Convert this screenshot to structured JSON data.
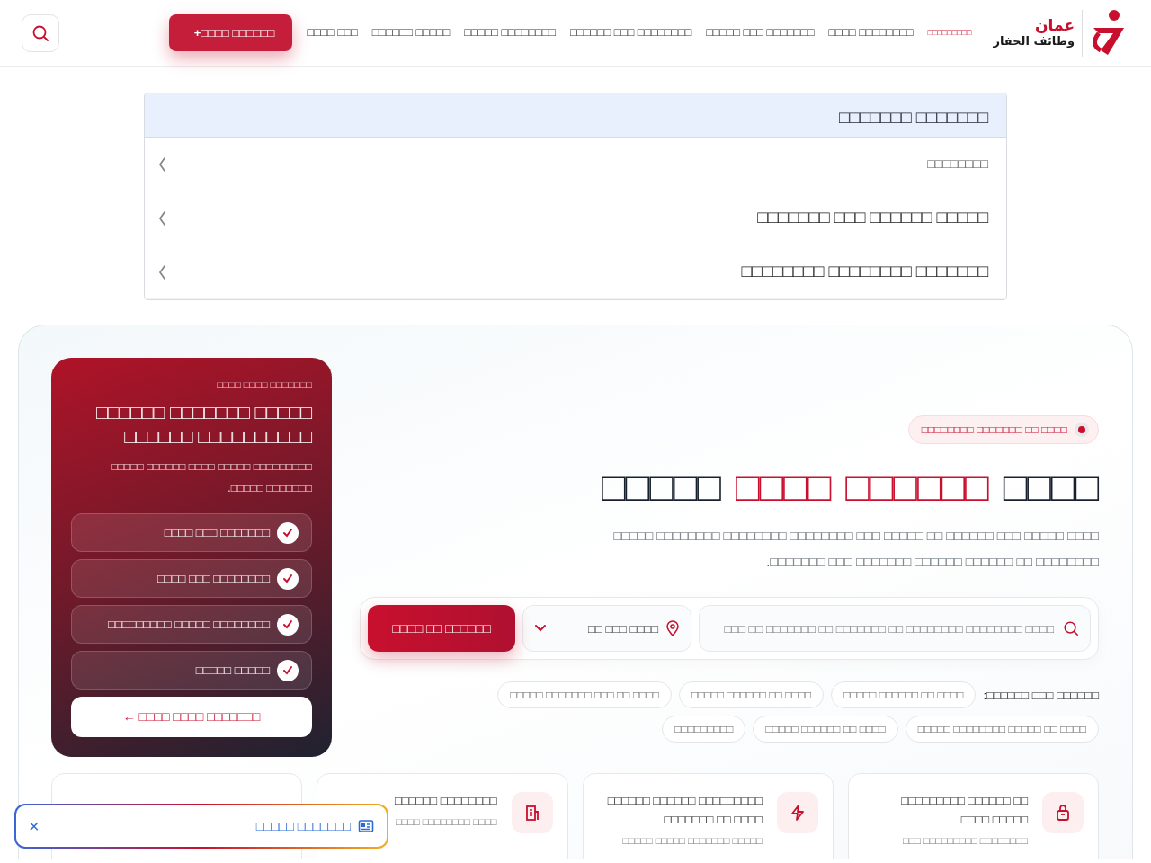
{
  "header": {
    "logo": {
      "line_1": "عمان",
      "line_2": "وظائف الحفار"
    },
    "nav": [
      {
        "label": "□□□ □□□□",
        "selected": false
      },
      {
        "label": "□□□□□ □□□□□□",
        "selected": false
      },
      {
        "label": "□□□□□□□□ □□□□□",
        "selected": false
      },
      {
        "label": "□□□□□□□□ □□□ □□□□□□",
        "selected": false
      },
      {
        "label": "□□□□□□□ □□□ □□□□□",
        "selected": false
      },
      {
        "label": "□□□□□□□□ □□□□",
        "selected": false
      },
      {
        "label": "□□□□□□□□□",
        "selected": true
      }
    ],
    "post_button": {
      "icon": "+",
      "label": "□□□□□□ □□□□"
    }
  },
  "menu": {
    "title": "□□□□□□□ □□□□□□□",
    "items": [
      {
        "label": "□□□□□□□□",
        "kind": "muted"
      },
      {
        "label": "□□□□□ □□□□□□ □□□ □□□□□□□",
        "kind": "normal"
      },
      {
        "label": "□□□□□□□ □□□□□□□□ □□□□□□□□",
        "kind": "normal"
      }
    ]
  },
  "hero": {
    "badge": "□□□□ □□ □□□□□□□ □□□□□□□□",
    "title": [
      {
        "text": "□□□□□",
        "highlight": false
      },
      {
        "text": "□□□□",
        "highlight": true
      },
      {
        "text": "□□□□□□",
        "highlight": true
      },
      {
        "text": "□□□□",
        "highlight": false
      }
    ],
    "text": "□□□□ □□□□□ □□□ □□□□□□ □□ □□□□□ □□□ □□□□□□□□ □□□□□□□□ □□□□□□□□ □□□□□ □□□□□□□□ □□ □□□□□□ □□□□□□ □□□□□□□ □□□ □□□□□□□.",
    "search": {
      "placeholder": "□□□□ □□□□□□□□ □□□□□□□□ □□ □□□□□□□ □□ □□□□□□□ □□ □□□",
      "location": "□□□□ □□□ □□",
      "button": "□□□□□□ □□ □□□□"
    },
    "popular_label": "□□□□□□ □□□ □□□□□□:",
    "tag_rows": [
      [
        "□□□□ □□ □□□ □□□□□□□ □□□□□",
        "□□□□ □□ □□□□□□ □□□□□",
        "□□□□ □□ □□□□□□ □□□□□"
      ],
      [
        "□□□□□□□□□",
        "□□□□ □□ □□□□□□ □□□□□",
        "□□□□ □□ □□□□□ □□□□□□□□ □□□□□"
      ]
    ]
  },
  "promo": {
    "kicker": "□□□□□□□ □□□□ □□□□",
    "title": "□□□□□ □□□□□□□ □□□□□□ □□□□□□□□□□ □□□□□□",
    "text": "□□□□□□□□□ □□□□□ □□□□ □□□□□□ □□□□□ □□□□□□□ □□□□□.",
    "features": [
      "□□□□□□□ □□□ □□□□",
      "□□□□□□□□ □□□ □□□□",
      "□□□□□□□□ □□□□□ □□□□□□□□□",
      "□□□□□ □□□□□"
    ],
    "button": "□□□□□□□ □□□□ □□□□ ←"
  },
  "cards": [
    {
      "kind": "hidden"
    },
    {
      "kind": "building",
      "title": "□□□□□□□□ □□□□□□",
      "subtitle": "□□□□ □□□□□□□□ □□□□"
    },
    {
      "kind": "bolt",
      "title": "□□□□□□□□□ □□□□□□ □□□□□□ □□□□ □□ □□□□□□□",
      "subtitle": "□□□□□ □□□□□□□ □□□□□ □□□□□"
    },
    {
      "kind": "lock",
      "title": "□□ □□□□□□ □□□□□□□□□ □□□□□ □□□□",
      "subtitle": "□□□□□□□□ □□□□□□□□□ □□□"
    }
  ],
  "floating_bar": {
    "label": "□□□□□□□ □□□□□",
    "close": "×"
  }
}
